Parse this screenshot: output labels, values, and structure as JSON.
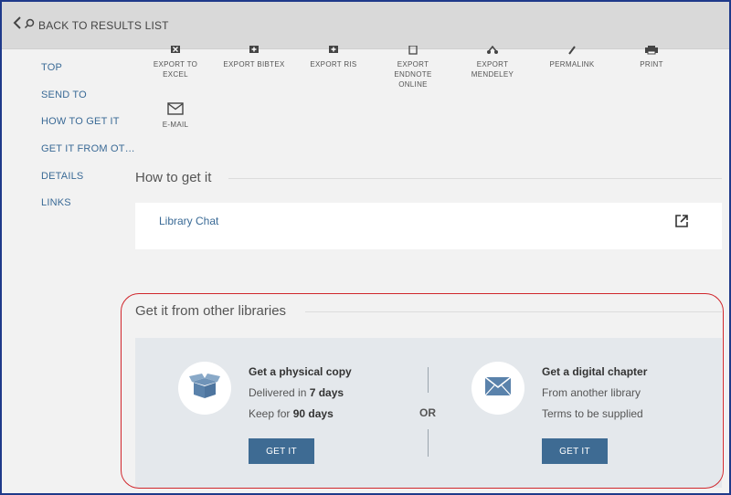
{
  "topbar": {
    "back_label": "BACK TO RESULTS LIST"
  },
  "sidenav": {
    "items": [
      {
        "label": "TOP"
      },
      {
        "label": "SEND TO"
      },
      {
        "label": "HOW TO GET IT"
      },
      {
        "label": "GET IT FROM OT…"
      },
      {
        "label": "DETAILS"
      },
      {
        "label": "LINKS"
      }
    ]
  },
  "actions": {
    "items": [
      {
        "label": "EXPORT TO\nEXCEL",
        "icon": "excel-icon"
      },
      {
        "label": "EXPORT BIBTEX",
        "icon": "bibtex-icon"
      },
      {
        "label": "EXPORT RIS",
        "icon": "ris-icon"
      },
      {
        "label": "EXPORT\nENDNOTE\nONLINE",
        "icon": "endnote-icon"
      },
      {
        "label": "EXPORT\nMENDELEY",
        "icon": "mendeley-icon"
      },
      {
        "label": "PERMALINK",
        "icon": "link-icon"
      },
      {
        "label": "PRINT",
        "icon": "print-icon"
      },
      {
        "label": "E-MAIL",
        "icon": "mail-icon"
      }
    ]
  },
  "how_to_get": {
    "title": "How to get it",
    "link_label": "Library Chat",
    "external_icon": "external-link-icon"
  },
  "other_libraries": {
    "title": "Get it from other libraries",
    "physical": {
      "title": "Get a physical copy",
      "line1_prefix": "Delivered in ",
      "line1_bold": "7 days",
      "line2_prefix": "Keep for ",
      "line2_bold": "90 days",
      "button": "GET IT",
      "icon": "box-icon"
    },
    "or_label": "OR",
    "digital": {
      "title": "Get a digital chapter",
      "line1": "From another library",
      "line2": "Terms to be supplied",
      "button": "GET IT",
      "icon": "envelope-icon"
    }
  },
  "colors": {
    "link": "#3a6a96",
    "button": "#3e6b93",
    "highlight": "#d0262c",
    "topbar": "#d9d9d9"
  }
}
